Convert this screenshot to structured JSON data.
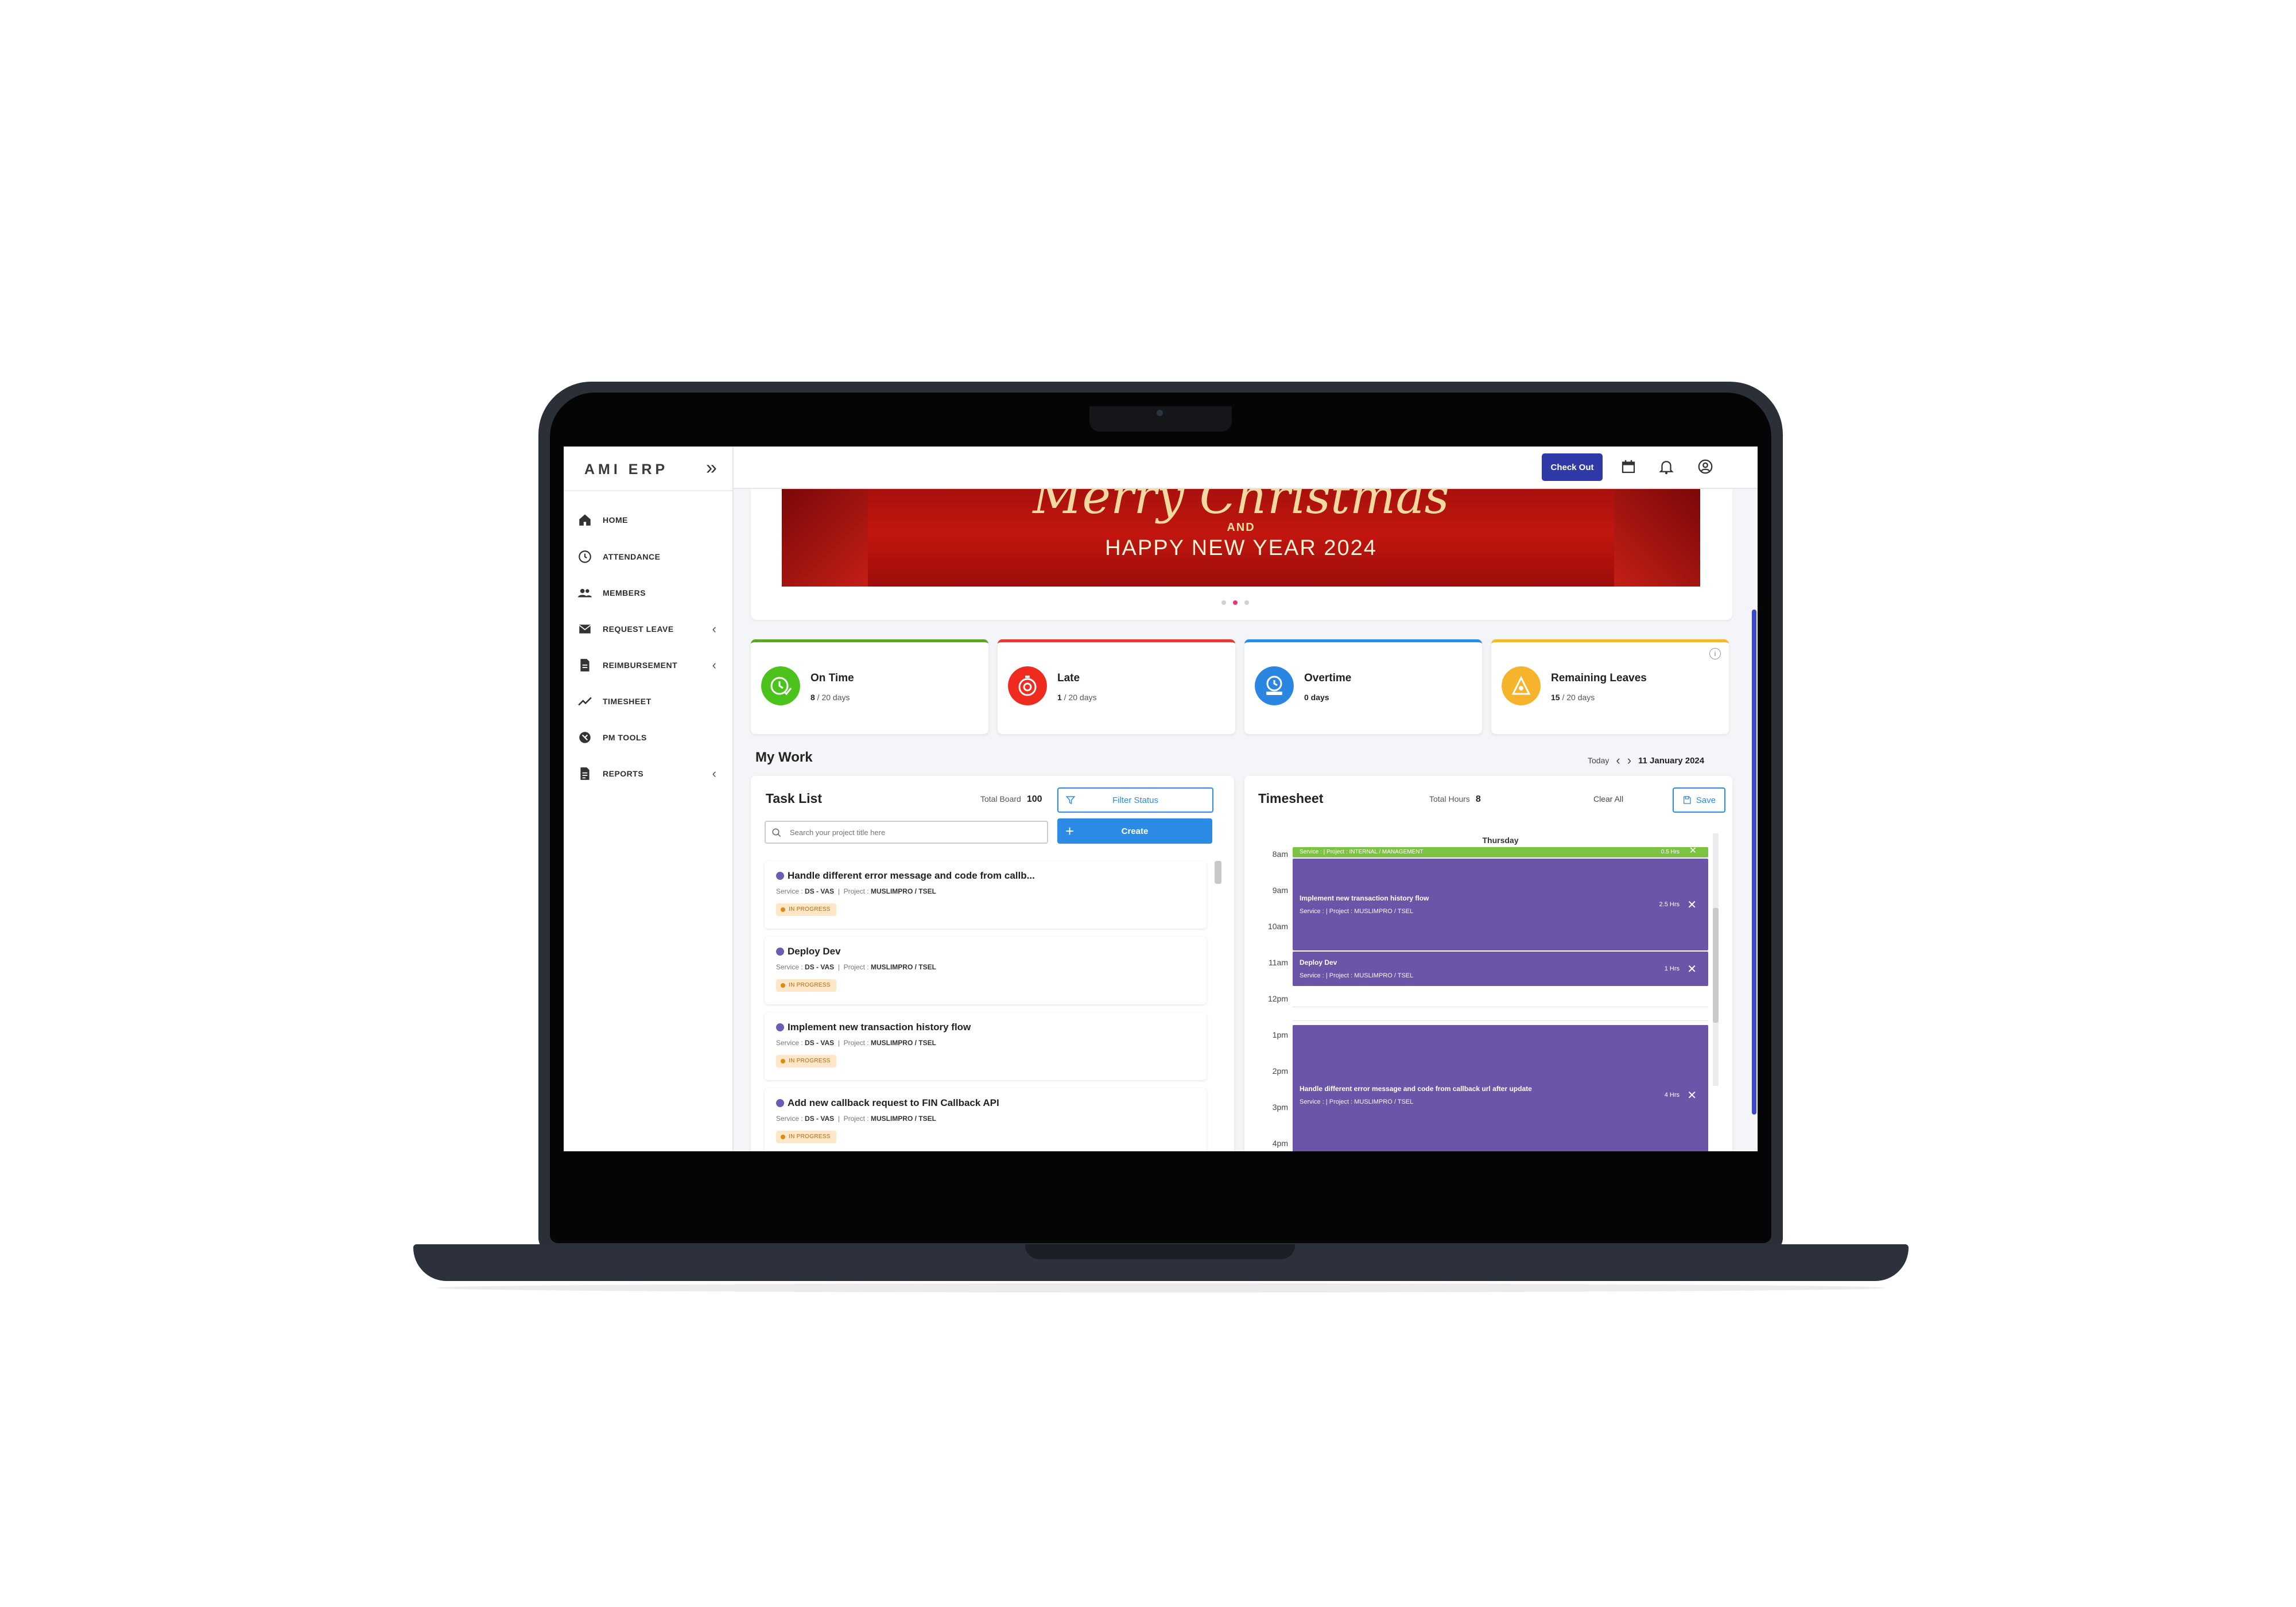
{
  "app": {
    "brand": "AMI ERP"
  },
  "sidebar": {
    "items": [
      {
        "label": "HOME",
        "icon": "home-icon"
      },
      {
        "label": "ATTENDANCE",
        "icon": "clock-icon"
      },
      {
        "label": "MEMBERS",
        "icon": "people-icon"
      },
      {
        "label": "REQUEST LEAVE",
        "icon": "mail-icon",
        "has_submenu": true
      },
      {
        "label": "REIMBURSEMENT",
        "icon": "receipt-icon",
        "has_submenu": true
      },
      {
        "label": "TIMESHEET",
        "icon": "trend-icon"
      },
      {
        "label": "PM TOOLS",
        "icon": "tools-icon"
      },
      {
        "label": "REPORTS",
        "icon": "document-icon",
        "has_submenu": true
      }
    ]
  },
  "topbar": {
    "checkout_label": "Check Out"
  },
  "banner": {
    "script_text": "Merry Christmas",
    "and_text": "AND",
    "headline": "HAPPY NEW YEAR 2024",
    "slides": 3,
    "active_slide": 2
  },
  "stats": [
    {
      "title": "On Time",
      "value": "8",
      "suffix": " / 20 days",
      "color": "#5aa52a",
      "icon_color": "#4cc21c"
    },
    {
      "title": "Late",
      "value": "1",
      "suffix": " / 20 days",
      "color": "#e53935",
      "icon_color": "#ef2b1f"
    },
    {
      "title": "Overtime",
      "value": "0 days",
      "suffix": "",
      "color": "#2b8be6",
      "icon_color": "#2a86e0"
    },
    {
      "title": "Remaining Leaves",
      "value": "15",
      "suffix": " / 20 days",
      "color": "#f5b82e",
      "icon_color": "#f6b42d"
    }
  ],
  "mywork": {
    "title": "My Work",
    "today_label": "Today",
    "date": "11 January 2024"
  },
  "tasklist": {
    "title": "Task List",
    "total_label": "Total Board",
    "total_value": "100",
    "filter_label": "Filter Status",
    "create_label": "Create",
    "search_placeholder": "Search your project title here",
    "tasks": [
      {
        "title": "Handle different error message and code from callb...",
        "service": "DS - VAS",
        "project": "MUSLIMPRO / TSEL",
        "status": "IN PROGRESS"
      },
      {
        "title": "Deploy Dev",
        "service": "DS - VAS",
        "project": "MUSLIMPRO / TSEL",
        "status": "IN PROGRESS"
      },
      {
        "title": "Implement new transaction history flow",
        "service": "DS - VAS",
        "project": "MUSLIMPRO / TSEL",
        "status": "IN PROGRESS"
      },
      {
        "title": "Add new callback request to FIN Callback API",
        "service": "DS - VAS",
        "project": "MUSLIMPRO / TSEL",
        "status": "IN PROGRESS"
      }
    ],
    "service_label": "Service :",
    "project_label": "Project :"
  },
  "timesheet": {
    "title": "Timesheet",
    "total_label": "Total Hours",
    "total_value": "8",
    "clear_label": "Clear All",
    "save_label": "Save",
    "day": "Thursday",
    "hours": [
      "8am",
      "9am",
      "10am",
      "11am",
      "12pm",
      "1pm",
      "2pm",
      "3pm",
      "4pm"
    ],
    "events": [
      {
        "title": "Service :  |  Project : INTERNAL / MANAGEMENT",
        "sub": "",
        "hrs": "0.5 Hrs",
        "color": "#7cc243"
      },
      {
        "title": "Implement new transaction history flow",
        "sub": "Service :  |  Project : MUSLIMPRO / TSEL",
        "hrs": "2.5 Hrs",
        "color": "#6a55a8"
      },
      {
        "title": "Deploy Dev",
        "sub": "Service :  |  Project : MUSLIMPRO / TSEL",
        "hrs": "1 Hrs",
        "color": "#6a55a8"
      },
      {
        "title": "Handle different error message and code from callback url after update",
        "sub": "Service :  |  Project : MUSLIMPRO / TSEL",
        "hrs": "4 Hrs",
        "color": "#6a55a8"
      }
    ]
  }
}
